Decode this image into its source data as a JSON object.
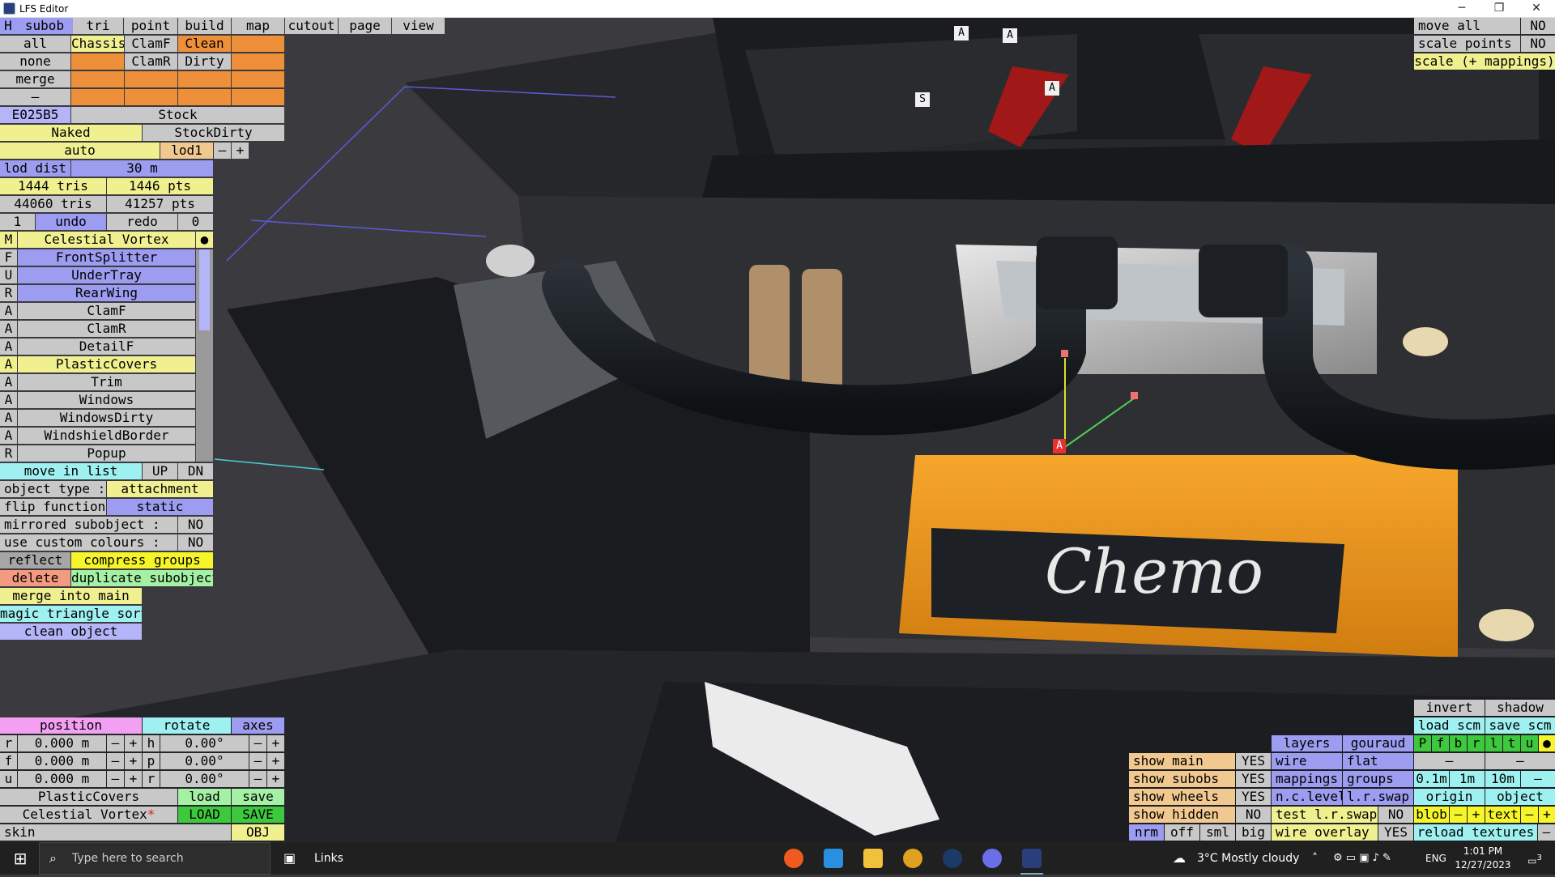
{
  "window": {
    "title": "LFS Editor",
    "min": "─",
    "max": "❐",
    "close": "✕"
  },
  "menu": {
    "h": "H",
    "tabs": [
      "subob",
      "tri",
      "point",
      "build",
      "map",
      "cutout",
      "page",
      "view"
    ]
  },
  "selection": {
    "all": "all",
    "none": "none",
    "merge": "merge",
    "dash": "–",
    "chassis": "Chassis",
    "clamf": "ClamF",
    "clamr": "ClamR",
    "clean": "Clean",
    "dirty": "Dirty"
  },
  "color": {
    "hex": "E025B5",
    "stock": "Stock",
    "naked": "Naked",
    "stockdirty": "StockDirty"
  },
  "lod": {
    "auto": "auto",
    "lod1": "lod1",
    "minus": "–",
    "plus": "+",
    "dist_label": "lod dist",
    "dist_value": "30 m"
  },
  "stats": {
    "tris1": "1444 tris",
    "pts1": "1446 pts",
    "tris2": "44060 tris",
    "pts2": "41257 pts"
  },
  "history": {
    "undo_count": "1",
    "undo": "undo",
    "redo": "redo",
    "redo_count": "0"
  },
  "object_list": {
    "header_letter": "M",
    "header_name": "Celestial Vortex",
    "header_dot": "●",
    "items": [
      {
        "l": "F",
        "n": "FrontSplitter"
      },
      {
        "l": "U",
        "n": "UnderTray"
      },
      {
        "l": "R",
        "n": "RearWing"
      },
      {
        "l": "A",
        "n": "ClamF"
      },
      {
        "l": "A",
        "n": "ClamR"
      },
      {
        "l": "A",
        "n": "DetailF"
      },
      {
        "l": "A",
        "n": "PlasticCovers"
      },
      {
        "l": "A",
        "n": "Trim"
      },
      {
        "l": "A",
        "n": "Windows"
      },
      {
        "l": "A",
        "n": "WindowsDirty"
      },
      {
        "l": "A",
        "n": "WindshieldBorder"
      },
      {
        "l": "R",
        "n": "Popup"
      }
    ]
  },
  "props": {
    "move_in_list": "move in list",
    "up": "UP",
    "dn": "DN",
    "object_type_label": "object type :",
    "object_type": "attachment",
    "flip_label": "flip function :",
    "flip": "static",
    "mirrored_label": "mirrored subobject :",
    "mirrored": "NO",
    "custom_label": "use custom colours :",
    "custom": "NO",
    "reflect": "reflect",
    "compress": "compress groups",
    "delete": "delete",
    "duplicate": "duplicate subobject",
    "merge_main": "merge into main",
    "magic_sort": "magic triangle sort",
    "clean_object": "clean object"
  },
  "top_right": {
    "move_all": "move all",
    "move_all_v": "NO",
    "scale_points": "scale points",
    "scale_points_v": "NO",
    "scale_mappings": "scale (+ mappings)"
  },
  "transform": {
    "position": "position",
    "rotate": "rotate",
    "axes": "axes",
    "r": "r",
    "f": "f",
    "u": "u",
    "h": "h",
    "p": "p",
    "rr": "r",
    "r_val": "0.000 m",
    "f_val": "0.000 m",
    "u_val": "0.000 m",
    "h_val": "0.00°",
    "p_val": "0.00°",
    "rr_val": "0.00°",
    "minus": "–",
    "plus": "+"
  },
  "files": {
    "sub_name": "PlasticCovers",
    "load": "load",
    "save": "save",
    "obj_name": "Celestial Vortex",
    "star": "*",
    "LOAD": "LOAD",
    "SAVE": "SAVE",
    "skin": "skin",
    "obj": "OBJ"
  },
  "view": {
    "show_main": "show main",
    "show_main_v": "YES",
    "show_subobs": "show subobs",
    "show_subobs_v": "YES",
    "show_wheels": "show wheels",
    "show_wheels_v": "YES",
    "show_hidden": "show hidden",
    "show_hidden_v": "NO",
    "nrm": "nrm",
    "off": "off",
    "sml": "sml",
    "big": "big",
    "layers": "layers",
    "gouraud": "gouraud",
    "wire": "wire",
    "flat": "flat",
    "mappings": "mappings",
    "groups": "groups",
    "nclevel": "n.c.level",
    "lrswap": "l.r.swap",
    "test_lrswap": "test l.r.swap",
    "test_lrswap_v": "NO",
    "wire_overlay": "wire overlay",
    "wire_overlay_v": "YES",
    "invert": "invert",
    "shadow": "shadow",
    "load_scm": "load scm",
    "save_scm": "save scm",
    "letters": [
      "P",
      "f",
      "b",
      "r",
      "l",
      "t",
      "u"
    ],
    "dot": "●",
    "dash": "–",
    "m01": "0.1m",
    "m1": "1m",
    "m10": "10m",
    "origin": "origin",
    "object": "object",
    "blob": "blob",
    "text": "text",
    "reload": "reload textures"
  },
  "scene": {
    "engine_text": "Chemo",
    "markers": [
      "A",
      "A",
      "A",
      "S",
      "A"
    ]
  },
  "taskbar": {
    "search_placeholder": "Type here to search",
    "links": "Links",
    "weather": "3°C  Mostly cloudy",
    "lang": "ENG",
    "time": "1:01 PM",
    "date": "12/27/2023",
    "notif": "3"
  },
  "colors": {
    "accent_orange": "#f5a020",
    "panel_blue": "#9c9cf0",
    "panel_yellow": "#f0f090"
  }
}
